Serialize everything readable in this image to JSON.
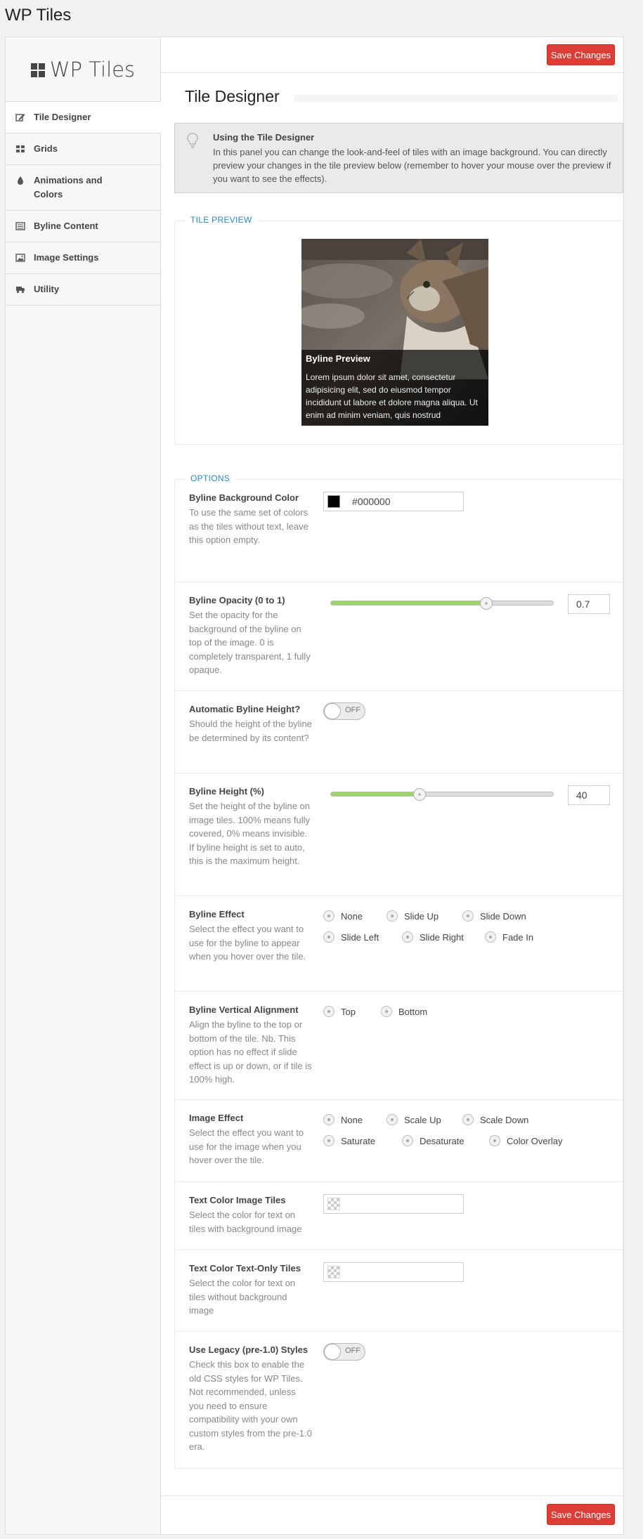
{
  "app": {
    "title": "WP Tiles",
    "logo_text": "WP Tiles"
  },
  "sidebar": {
    "items": [
      {
        "label": "Tile Designer",
        "icon": "pencil-edit-icon",
        "active": true
      },
      {
        "label": "Grids",
        "icon": "grid-icon"
      },
      {
        "label": "Animations and Colors",
        "icon": "droplet-icon"
      },
      {
        "label": "Byline Content",
        "icon": "list-icon"
      },
      {
        "label": "Image Settings",
        "icon": "image-icon"
      },
      {
        "label": "Utility",
        "icon": "truck-icon"
      }
    ]
  },
  "toolbar": {
    "save_label": "Save Changes"
  },
  "section": {
    "title": "Tile Designer"
  },
  "info": {
    "heading": "Using the Tile Designer",
    "body": "In this panel you can change the look-and-feel of tiles with an image background. You can directly preview your changes in the tile preview below (remember to hover your mouse over the preview if you want to see the effects)."
  },
  "preview": {
    "legend": "TILE PREVIEW",
    "byline_title": "Byline Preview",
    "byline_text": "Lorem ipsum dolor sit amet, consectetur adipisicing elit, sed do eiusmod tempor incididunt ut labore et dolore magna aliqua. Ut enim ad minim veniam, quis nostrud"
  },
  "options": {
    "legend": "OPTIONS",
    "bg_color": {
      "label": "Byline Background Color",
      "desc": "To use the same set of colors as the tiles without text, leave this option empty.",
      "value": "#000000"
    },
    "opacity": {
      "label": "Byline Opacity (0 to 1)",
      "desc": "Set the opacity for the background of the byline on top of the image. 0 is completely transparent, 1 fully opaque.",
      "value": "0.7",
      "fraction": 0.7
    },
    "auto_height": {
      "label": "Automatic Byline Height?",
      "desc": "Should the height of the byline be determined by its content?",
      "state": "OFF"
    },
    "height": {
      "label": "Byline Height (%)",
      "desc": "Set the height of the byline on image tiles. 100% means fully covered, 0% means invisible. If byline height is set to auto, this is the maximum height.",
      "value": "40",
      "fraction": 0.4
    },
    "effect": {
      "label": "Byline Effect",
      "desc": "Select the effect you want to use for the byline to appear when you hover over the tile.",
      "choices": [
        "None",
        "Slide Up",
        "Slide Down",
        "Slide Left",
        "Slide Right",
        "Fade In"
      ]
    },
    "valign": {
      "label": "Byline Vertical Alignment",
      "desc": "Align the byline to the top or bottom of the tile. Nb. This option has no effect if slide effect is up or down, or if tile is 100% high.",
      "choices": [
        "Top",
        "Bottom"
      ]
    },
    "image_effect": {
      "label": "Image Effect",
      "desc": "Select the effect you want to use for the image when you hover over the tile.",
      "choices": [
        "None",
        "Scale Up",
        "Scale Down",
        "Saturate",
        "Desaturate",
        "Color Overlay"
      ]
    },
    "text_color_img": {
      "label": "Text Color Image Tiles",
      "desc": "Select the color for text on tiles with background image"
    },
    "text_color_txt": {
      "label": "Text Color Text-Only Tiles",
      "desc": "Select the color for text on tiles without background image"
    },
    "legacy": {
      "label": "Use Legacy (pre-1.0) Styles",
      "desc": "Check this box to enable the old CSS styles for WP Tiles. Not recommended, unless you need to ensure compatibility with your own custom styles from the pre-1.0 era.",
      "state": "OFF"
    }
  }
}
